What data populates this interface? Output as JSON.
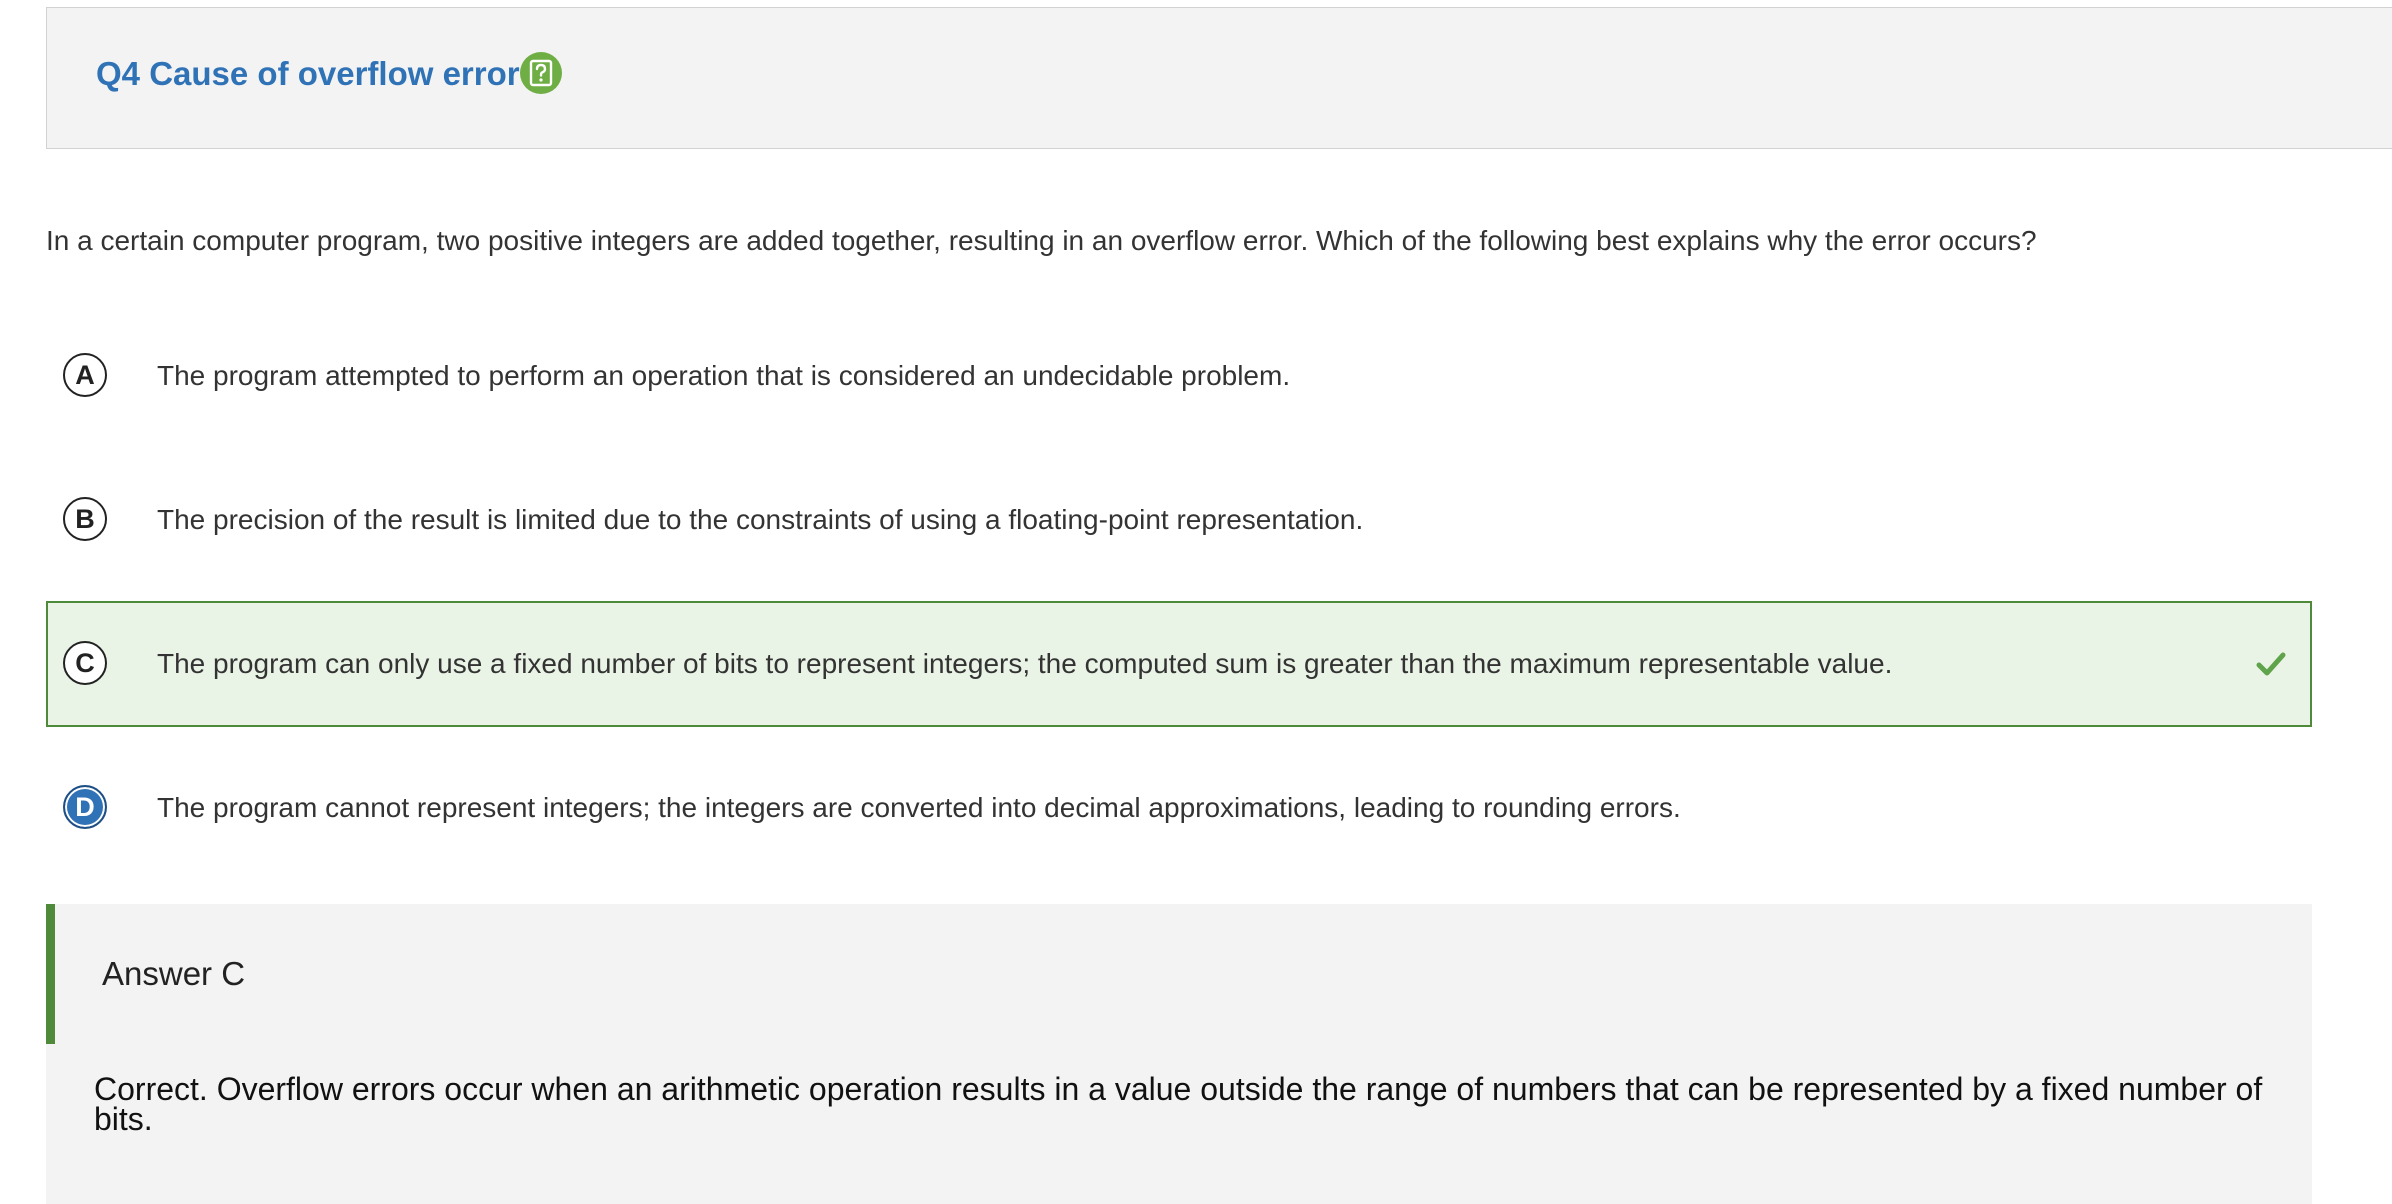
{
  "header": {
    "title": "Q4 Cause of overflow error",
    "help_icon": "help-question-icon",
    "help_icon_color": "#6fae44",
    "title_color": "#2f72b6"
  },
  "question": {
    "text": "In a certain computer program, two positive integers are added together, resulting in an overflow error. Which of the following best explains why the error occurs?"
  },
  "options": [
    {
      "letter": "A",
      "text": "The program attempted to perform an operation that is considered an undecidable problem.",
      "correct": false,
      "selected": false
    },
    {
      "letter": "B",
      "text": "The precision of the result is limited due to the constraints of using a floating-point representation.",
      "correct": false,
      "selected": false
    },
    {
      "letter": "C",
      "text": "The program can only use a fixed number of bits to represent integers; the computed sum is greater than the maximum representable value.",
      "correct": true,
      "selected": false
    },
    {
      "letter": "D",
      "text": "The program cannot represent integers; the integers are converted into decimal approximations, leading to rounding errors.",
      "correct": false,
      "selected": true
    }
  ],
  "answer": {
    "label": "Answer C",
    "explanation": "Correct. Overflow errors occur when an arithmetic operation results in a value outside the range of numbers that can be represented by a fixed number of bits."
  },
  "colors": {
    "correct_border": "#4e8a3a",
    "correct_background": "#eaf4e6",
    "selected_letter": "#2f72b6",
    "checkmark": "#5fa34a"
  }
}
